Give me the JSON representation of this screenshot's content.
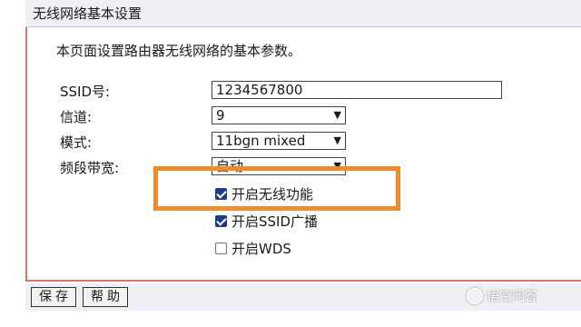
{
  "page": {
    "title": "无线网络基本设置",
    "description": "本页面设置路由器无线网络的基本参数。"
  },
  "form": {
    "ssid": {
      "label": "SSID号:",
      "value": "1234567800"
    },
    "channel": {
      "label": "信道:",
      "value": "9"
    },
    "mode": {
      "label": "模式:",
      "value": "11bgn mixed"
    },
    "bandwidth": {
      "label": "频段带宽:",
      "value": "自动"
    }
  },
  "checkboxes": [
    {
      "label": "开启无线功能",
      "checked": true
    },
    {
      "label": "开启SSID广播",
      "checked": true
    },
    {
      "label": "开启WDS",
      "checked": false
    }
  ],
  "buttons": {
    "save": "保存",
    "help": "帮助"
  },
  "watermark": {
    "text": "悟空问答"
  },
  "colors": {
    "highlight": "#f08a2c",
    "panel_border": "#d8726c",
    "checkbox_checked": "#1f3a8a"
  }
}
